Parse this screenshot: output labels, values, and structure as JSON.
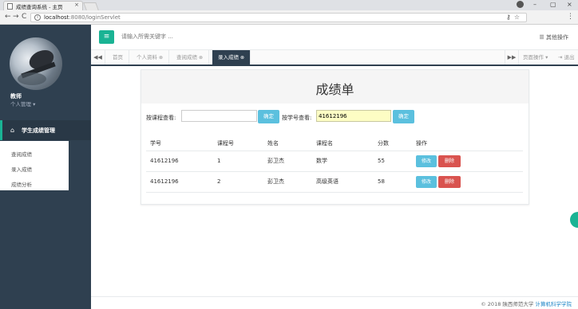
{
  "browser": {
    "tab_title": "成绩查询系统 - 主页",
    "tab_close": "×",
    "url_host": "localhost",
    "url_rest": ":8080/loginServlet",
    "win_min": "–",
    "win_max": "▢",
    "win_close": "×",
    "back": "←",
    "forward": "→",
    "reload": "C",
    "info": "i",
    "omni_icons": "⚷☆",
    "menu": "⋮"
  },
  "sidebar": {
    "user_name": "教师",
    "user_role": "个人管理 ▾",
    "home_icon": "⌂",
    "nav_label": "学生成绩管理",
    "items": [
      {
        "label": "查阅成绩"
      },
      {
        "label": "录入成绩"
      },
      {
        "label": "成绩分析"
      }
    ]
  },
  "topbar": {
    "menu_icon": "≡",
    "search_placeholder": "请输入所需关键字 ...",
    "more_ops": "☰ 其他操作"
  },
  "tabs": {
    "prev": "◀◀",
    "next": "▶▶",
    "items": [
      {
        "label": "首页",
        "closable": false
      },
      {
        "label": "个人资料",
        "closable": true
      },
      {
        "label": "查阅成绩",
        "closable": true
      },
      {
        "label": "录入成绩",
        "closable": true
      }
    ],
    "close_mark": "⊗",
    "page_ops": "页面操作 ▾",
    "logout": "⇥ 退出"
  },
  "card": {
    "title": "成绩单",
    "course_label": "按课程查看:",
    "course_value": "",
    "student_label": "按学号查看:",
    "student_value": "41612196",
    "confirm": "确定"
  },
  "table": {
    "headers": [
      "学号",
      "课程号",
      "姓名",
      "课程名",
      "分数",
      "操作"
    ],
    "rows": [
      {
        "student_id": "41612196",
        "course_id": "1",
        "name": "彭卫杰",
        "course_name": "数学",
        "score": "55"
      },
      {
        "student_id": "41612196",
        "course_id": "2",
        "name": "彭卫杰",
        "course_name": "高级英语",
        "score": "58"
      }
    ],
    "edit_label": "修改",
    "delete_label": "删除"
  },
  "footer": {
    "text": "© 2018 陕西师范大学",
    "link": "计算机科学学院"
  },
  "colors": {
    "accent": "#1ab394",
    "sidebar_bg": "#2f4050",
    "info_btn": "#5bc0de",
    "danger_btn": "#d9534f"
  }
}
